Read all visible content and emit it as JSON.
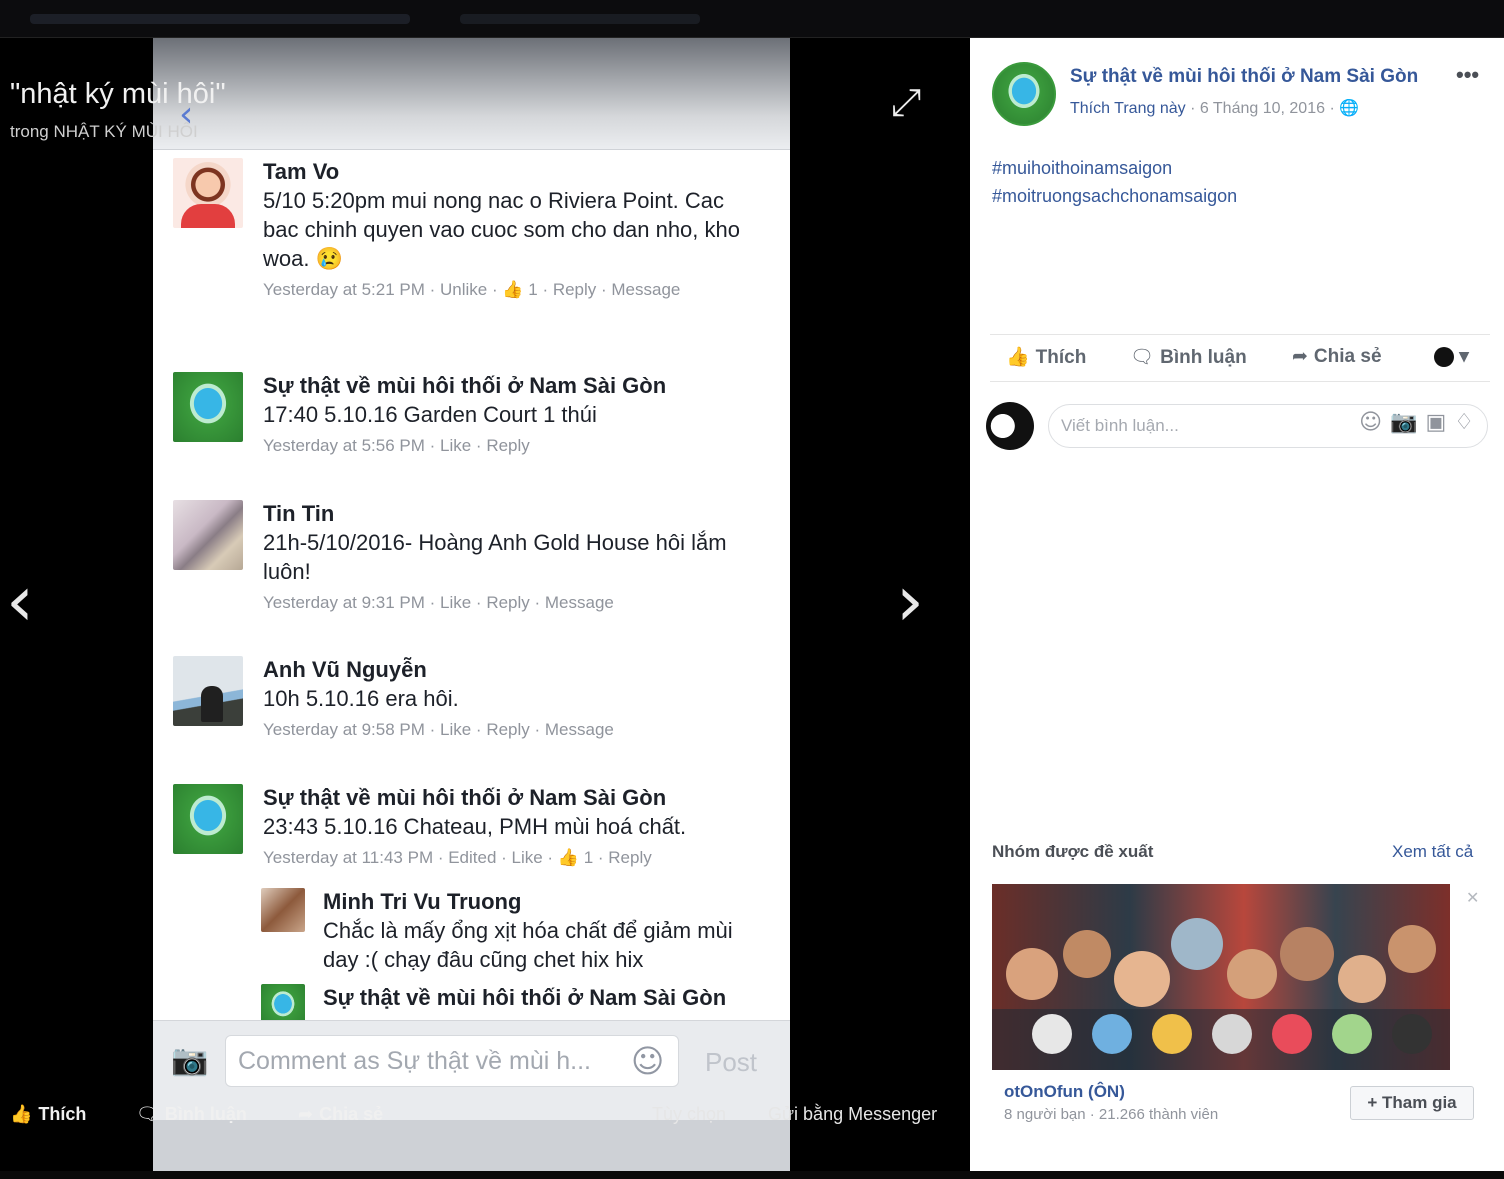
{
  "theater": {
    "album_title": "\"nhật ký mùi hôi\"",
    "album_sub": "trong NHẬT KÝ MÙI HÔI",
    "actions": {
      "like": "Thích",
      "comment": "Bình luận",
      "share": "Chia sẻ",
      "options": "Tùy chọn",
      "messenger": "Gửi bằng Messenger"
    }
  },
  "phone": {
    "comments": [
      {
        "name": "Tam Vo",
        "text": "5/10 5:20pm mui nong nac o Riviera Point. Cac bac chinh quyen vao cuoc som cho dan nho, kho woa. 😢",
        "meta": "Yesterday at 5:21 PM · Unlike · 👍 1 · Reply · Message"
      },
      {
        "name": "Sự thật về mùi hôi thối ở Nam Sài Gòn",
        "text": "17:40 5.10.16 Garden Court 1 thúi",
        "meta": "Yesterday at 5:56 PM · Like · Reply"
      },
      {
        "name": "Tin Tin",
        "text": "21h-5/10/2016- Hoàng Anh Gold House hôi lắm luôn!",
        "meta": "Yesterday at 9:31 PM · Like · Reply · Message"
      },
      {
        "name": "Anh Vũ Nguyễn",
        "text": "10h 5.10.16 era hôi.",
        "meta": "Yesterday at 9:58 PM · Like · Reply · Message"
      },
      {
        "name": "Sự thật về mùi hôi thối ở Nam Sài Gòn",
        "text": "23:43 5.10.16 Chateau, PMH mùi hoá chất.",
        "meta": "Yesterday at 11:43 PM · Edited · Like · 👍 1 · Reply"
      }
    ],
    "replies": [
      {
        "name": "Minh Tri Vu Truong",
        "text": "Chắc là mấy ổng xịt hóa chất để giảm mùi day :( chạy đâu cũng chet hix hix"
      },
      {
        "name": "Sự thật về mùi hôi thối ở Nam Sài Gòn",
        "text": ""
      }
    ],
    "comment_placeholder": "Comment as Sự thật về mùi h...",
    "post_label": "Post"
  },
  "panel": {
    "page_name": "Sự thật về mùi hôi thối ở Nam Sài Gòn",
    "more": "•••",
    "page_meta_like": "Thích Trang này",
    "page_meta_date": " · 6 Tháng 10, 2016 · ",
    "hashtags": [
      "#muihoithoinamsaigon",
      "#moitruongsachchonamsaigon"
    ],
    "actions": {
      "like": "Thích",
      "comment": "Bình luận",
      "share": "Chia sẻ"
    },
    "write_placeholder": "Viết bình luận...",
    "suggested_title": "Nhóm được đề xuất",
    "see_all": "Xem tất cả",
    "suggested_group_name": "otOnOfun (ÔN)",
    "suggested_group_meta": "8 người bạn · 21.266 thành viên",
    "join_label": "+ Tham gia"
  },
  "icons": {
    "back": "chevron-left-icon",
    "expand": "expand-icon",
    "prev": "chevron-left-icon",
    "next": "chevron-right-icon",
    "globe": "globe-icon"
  },
  "colors": {
    "link_blue": "#365899",
    "meta_gray": "#90949c",
    "theater_bg": "#000000"
  }
}
